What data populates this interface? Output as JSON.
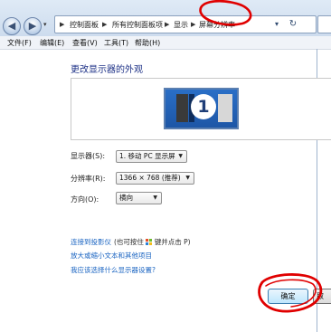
{
  "address_bar": {
    "crumbs": [
      "控制面板",
      "所有控制面板项",
      "显示",
      "屏幕分辨率"
    ],
    "refresh_glyph": "↻"
  },
  "menu": {
    "items": [
      "文件(F)",
      "编辑(E)",
      "查看(V)",
      "工具(T)",
      "帮助(H)"
    ]
  },
  "page": {
    "title": "更改显示器的外观",
    "monitor_number": "1",
    "fields": {
      "display": {
        "label": "显示器(S):",
        "value": "1. 移动 PC 显示屏"
      },
      "resolution": {
        "label": "分辨率(R):",
        "value": "1366 × 768 (推荐)"
      },
      "orientation": {
        "label": "方向(O):",
        "value": "横向"
      }
    },
    "projector_link": "连接到投影仪",
    "projector_hint_pre": "(也可按住",
    "projector_hint_post": "键并点击 P)",
    "text_size_link": "放大或缩小文本和其他项目",
    "settings_link": "我应该选择什么显示器设置?",
    "ok_button": "确定",
    "next_button": "取"
  },
  "colors": {
    "link": "#1a64c2",
    "title": "#1e3287",
    "annotation": "#e00000"
  },
  "icons": {
    "back": "back-arrow-icon",
    "forward": "forward-arrow-icon",
    "windows_key": "windows-logo-icon"
  }
}
